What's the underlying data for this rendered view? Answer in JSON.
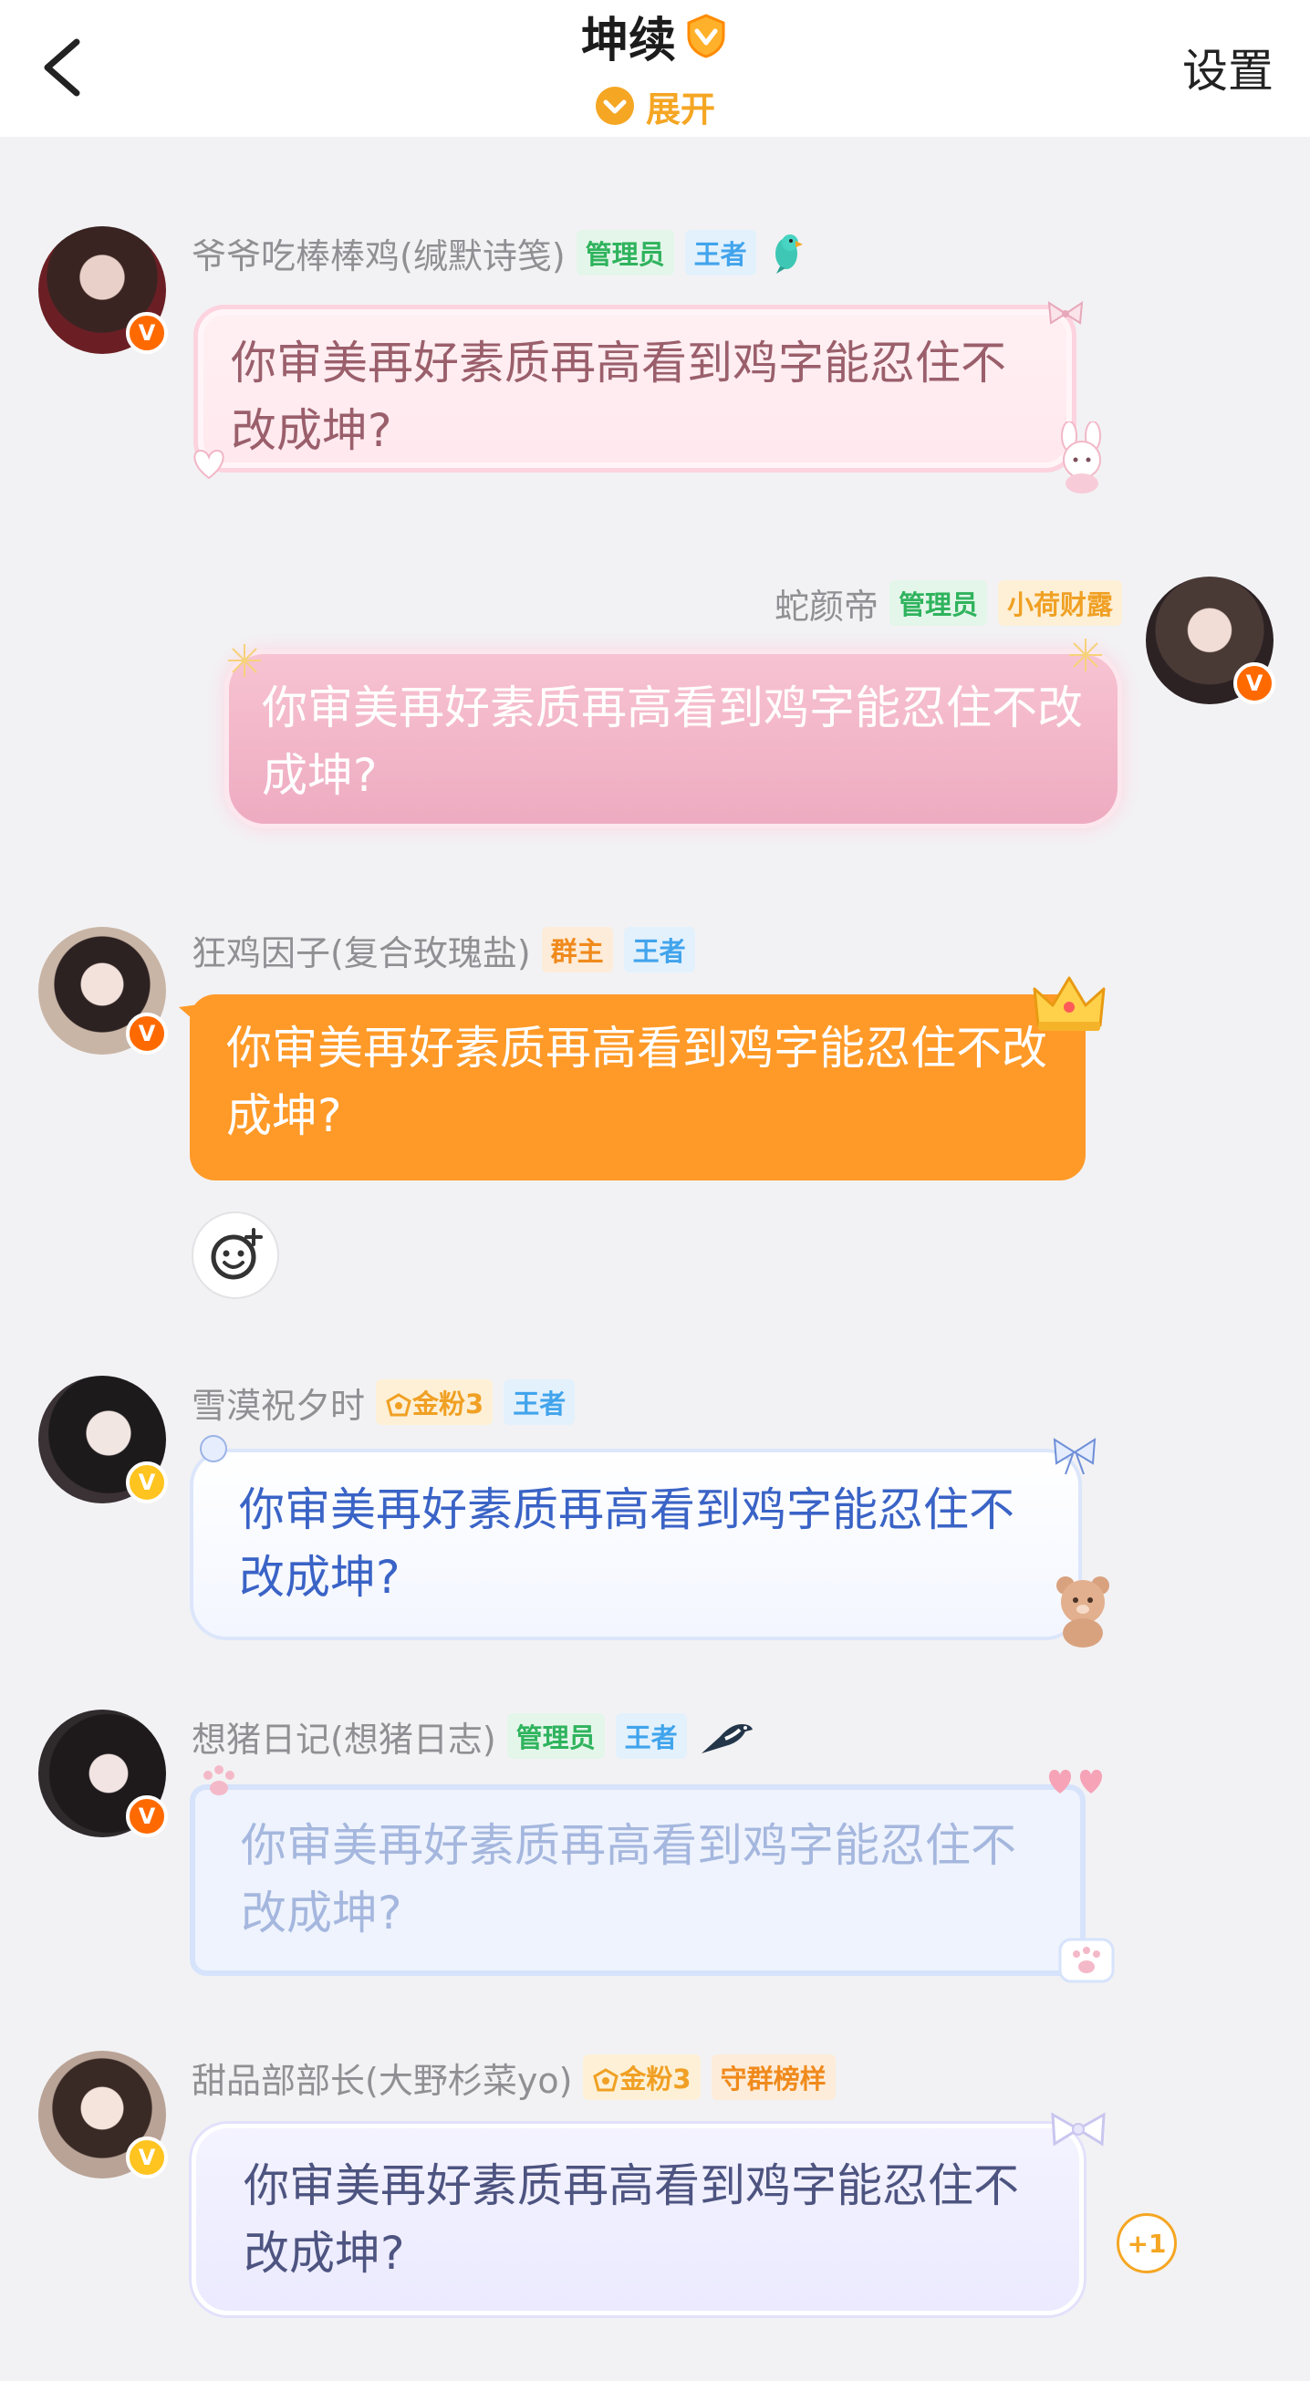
{
  "header": {
    "title": "坤续",
    "expand_label": "展开",
    "settings_label": "设置"
  },
  "colors": {
    "accent": "#f5a623",
    "verified_orange": "#ff6a00",
    "verified_yellow": "#ffc41f",
    "background": "#f2f2f4"
  },
  "messages": [
    {
      "sender": "爷爷吃棒棒鸡(缄默诗笺)",
      "tags": [
        "管理员",
        "王者"
      ],
      "text": "你审美再好素质再高看到鸡字能忍住不改成坤?",
      "icon": "parrot-icon"
    },
    {
      "sender": "蛇颜帝",
      "tags": [
        "管理员",
        "小荷财露"
      ],
      "text": "你审美再好素质再高看到鸡字能忍住不改成坤?"
    },
    {
      "sender": "狂鸡因子(复合玫瑰盐)",
      "tags": [
        "群主",
        "王者"
      ],
      "text": "你审美再好素质再高看到鸡字能忍住不改成坤?"
    },
    {
      "sender": "雪漠祝夕时",
      "tags": [
        "金粉3",
        "王者"
      ],
      "text": "你审美再好素质再高看到鸡字能忍住不改成坤?"
    },
    {
      "sender": "想猪日记(想猪日志)",
      "tags": [
        "管理员",
        "王者"
      ],
      "text": "你审美再好素质再高看到鸡字能忍住不改成坤?",
      "icon": "magpie-icon"
    },
    {
      "sender": "甜品部部长(大野杉菜yo)",
      "tags": [
        "金粉3",
        "守群榜样"
      ],
      "text": "你审美再好素质再高看到鸡字能忍住不改成坤?",
      "plus_one": "+1"
    }
  ]
}
